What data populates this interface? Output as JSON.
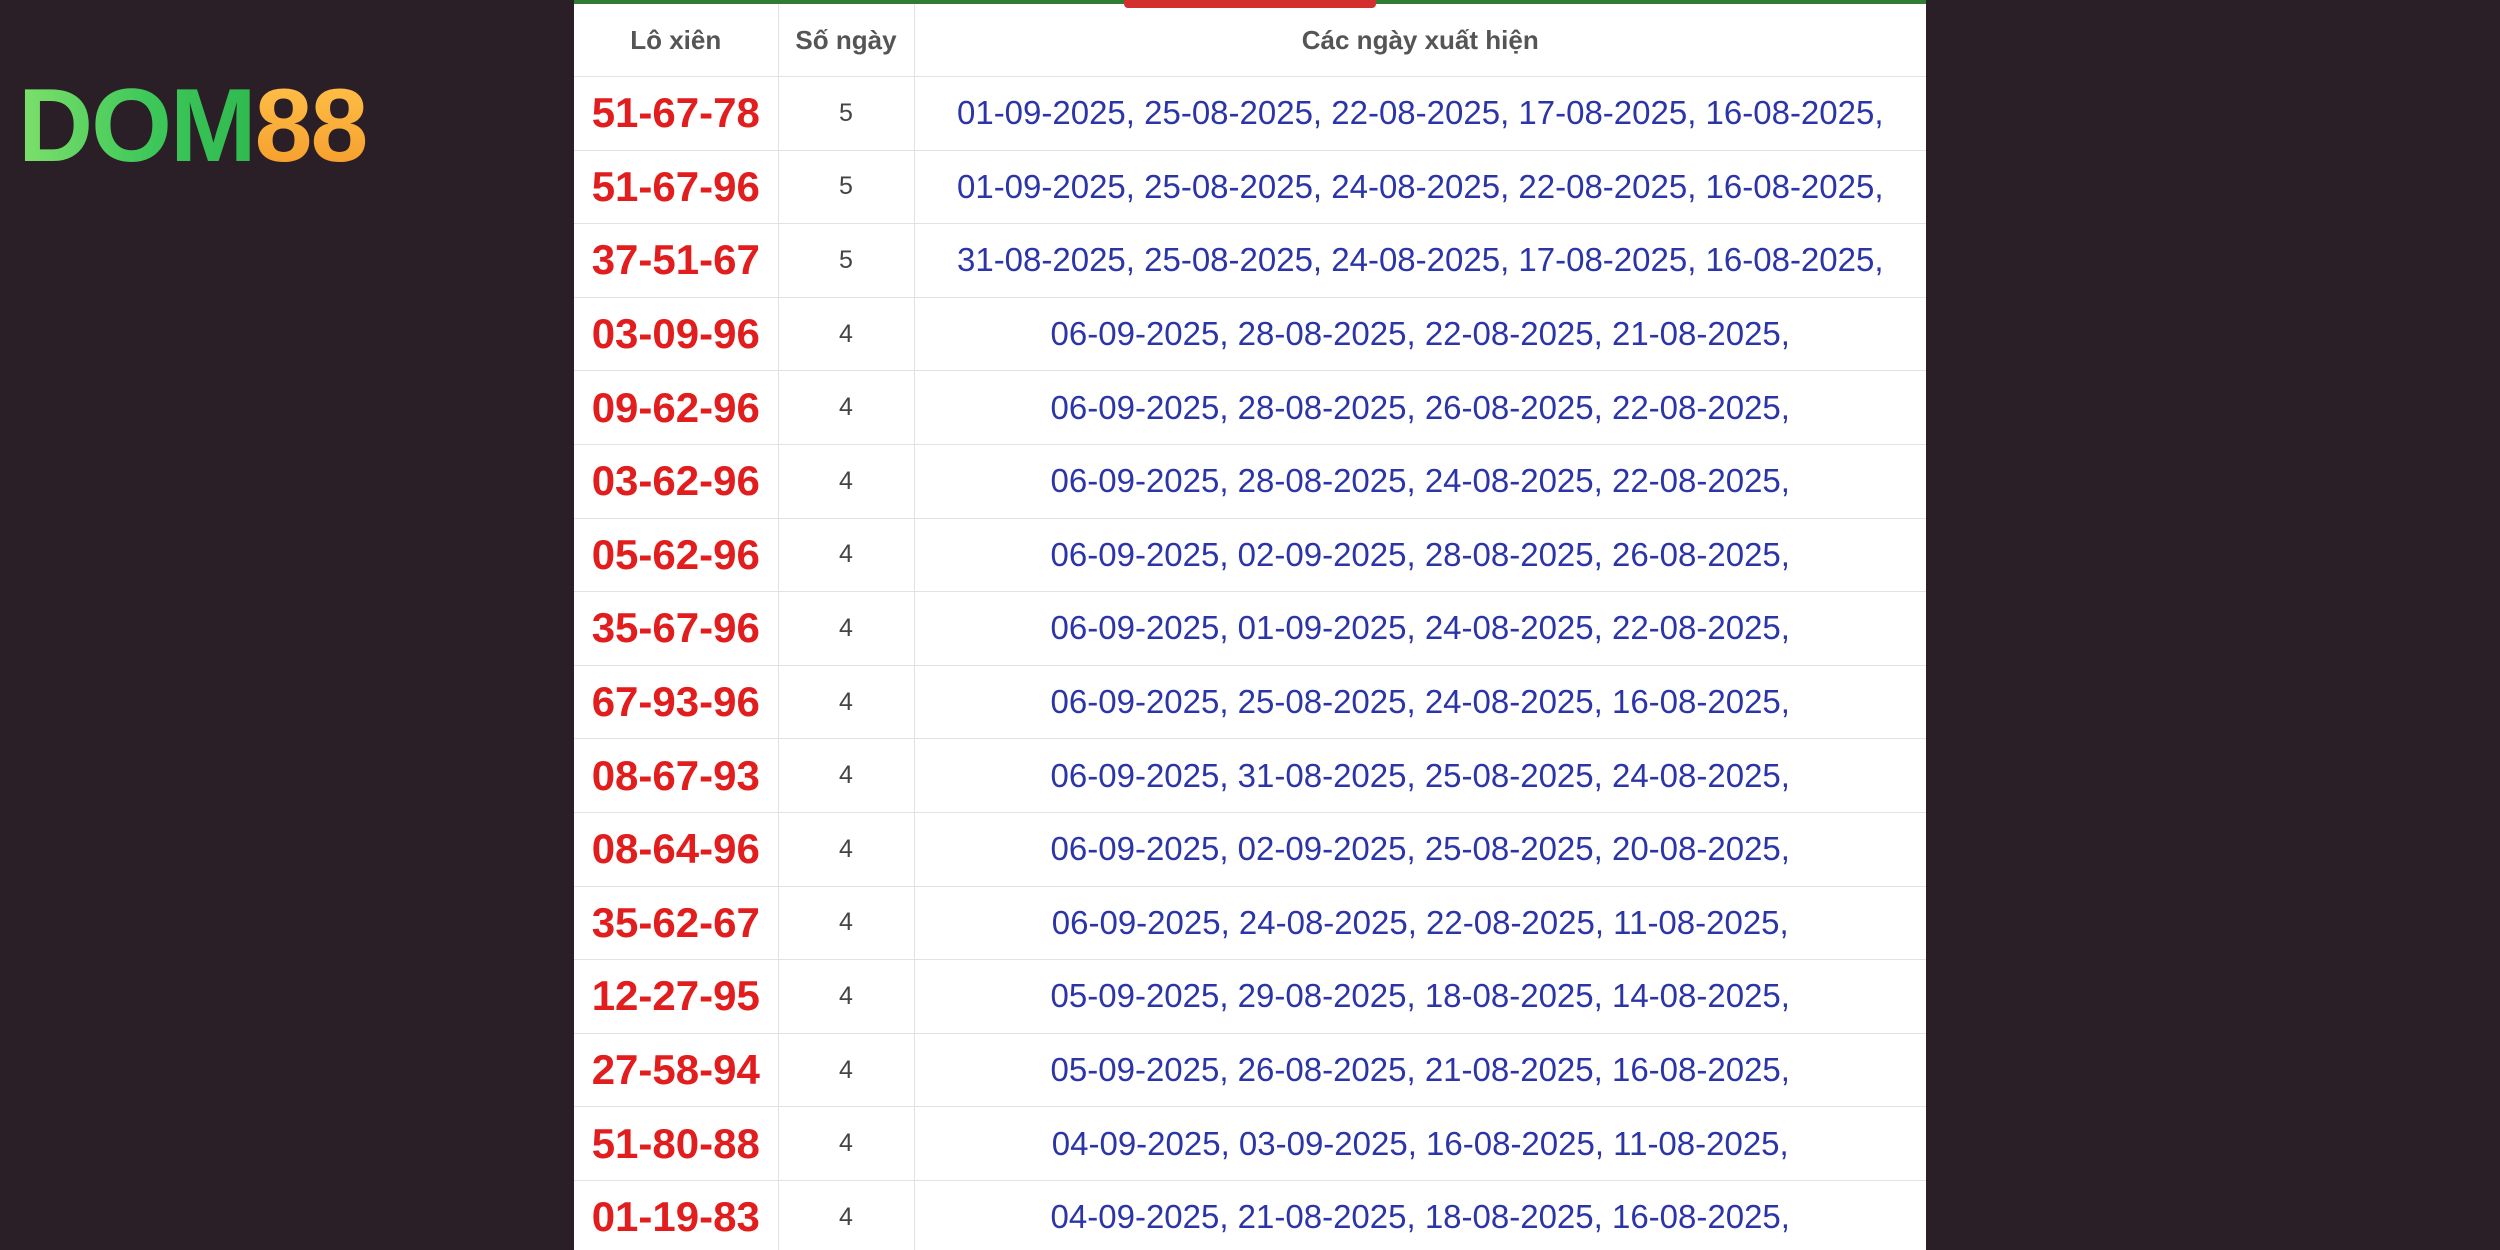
{
  "logo": {
    "part1": "DOM",
    "part2": "88"
  },
  "colors": {
    "background": "#2b1f27",
    "combo_red": "#e11d1d",
    "dates_blue": "#2b35a8",
    "logo_green": "#3ec85a",
    "logo_orange": "#f59b2a"
  },
  "table": {
    "headers": [
      "Lô xiên",
      "Số ngày",
      "Các ngày xuất hiện"
    ],
    "rows": [
      {
        "combo": "51-67-78",
        "days": "5",
        "dates": "01-09-2025, 25-08-2025, 22-08-2025, 17-08-2025, 16-08-2025,"
      },
      {
        "combo": "51-67-96",
        "days": "5",
        "dates": "01-09-2025, 25-08-2025, 24-08-2025, 22-08-2025, 16-08-2025,"
      },
      {
        "combo": "37-51-67",
        "days": "5",
        "dates": "31-08-2025, 25-08-2025, 24-08-2025, 17-08-2025, 16-08-2025,"
      },
      {
        "combo": "03-09-96",
        "days": "4",
        "dates": "06-09-2025, 28-08-2025, 22-08-2025, 21-08-2025,"
      },
      {
        "combo": "09-62-96",
        "days": "4",
        "dates": "06-09-2025, 28-08-2025, 26-08-2025, 22-08-2025,"
      },
      {
        "combo": "03-62-96",
        "days": "4",
        "dates": "06-09-2025, 28-08-2025, 24-08-2025, 22-08-2025,"
      },
      {
        "combo": "05-62-96",
        "days": "4",
        "dates": "06-09-2025, 02-09-2025, 28-08-2025, 26-08-2025,"
      },
      {
        "combo": "35-67-96",
        "days": "4",
        "dates": "06-09-2025, 01-09-2025, 24-08-2025, 22-08-2025,"
      },
      {
        "combo": "67-93-96",
        "days": "4",
        "dates": "06-09-2025, 25-08-2025, 24-08-2025, 16-08-2025,"
      },
      {
        "combo": "08-67-93",
        "days": "4",
        "dates": "06-09-2025, 31-08-2025, 25-08-2025, 24-08-2025,"
      },
      {
        "combo": "08-64-96",
        "days": "4",
        "dates": "06-09-2025, 02-09-2025, 25-08-2025, 20-08-2025,"
      },
      {
        "combo": "35-62-67",
        "days": "4",
        "dates": "06-09-2025, 24-08-2025, 22-08-2025, 11-08-2025,"
      },
      {
        "combo": "12-27-95",
        "days": "4",
        "dates": "05-09-2025, 29-08-2025, 18-08-2025, 14-08-2025,"
      },
      {
        "combo": "27-58-94",
        "days": "4",
        "dates": "05-09-2025, 26-08-2025, 21-08-2025, 16-08-2025,"
      },
      {
        "combo": "51-80-88",
        "days": "4",
        "dates": "04-09-2025, 03-09-2025, 16-08-2025, 11-08-2025,"
      },
      {
        "combo": "01-19-83",
        "days": "4",
        "dates": "04-09-2025, 21-08-2025, 18-08-2025, 16-08-2025,"
      }
    ]
  }
}
